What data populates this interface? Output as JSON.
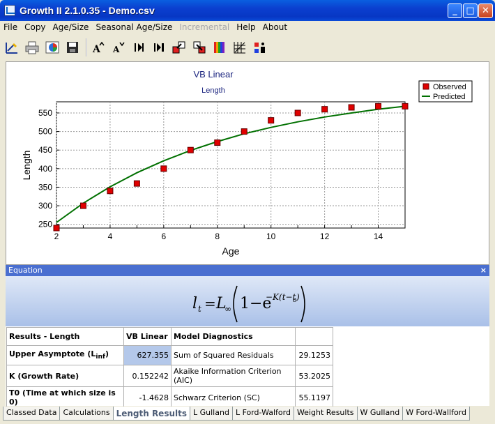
{
  "window": {
    "title": "Growth II 2.1.0.35 - Demo.csv",
    "min": "_",
    "max": "□",
    "close": "✕"
  },
  "menu": [
    "File",
    "Copy",
    "Age/Size",
    "Seasonal Age/Size",
    "Incremental",
    "Help",
    "About"
  ],
  "chart_data": {
    "type": "scatter",
    "title": "VB Linear",
    "subtitle": "Length",
    "xlabel": "Age",
    "ylabel": "Length",
    "xlim": [
      2,
      15
    ],
    "ylim": [
      240,
      580
    ],
    "xticks": [
      2,
      4,
      6,
      8,
      10,
      12,
      14
    ],
    "yticks": [
      250,
      300,
      350,
      400,
      450,
      500,
      550
    ],
    "grid": true,
    "legend_position": "top-right",
    "series": [
      {
        "name": "Observed",
        "kind": "markers",
        "color": "#e00000",
        "x": [
          2,
          3,
          4,
          5,
          6,
          7,
          8,
          9,
          10,
          11,
          12,
          13,
          14,
          15
        ],
        "y": [
          240,
          300,
          340,
          360,
          400,
          450,
          470,
          500,
          530,
          550,
          560,
          565,
          568,
          568
        ]
      },
      {
        "name": "Predicted",
        "kind": "line",
        "color": "#007000",
        "x": [
          2,
          3,
          4,
          5,
          6,
          7,
          8,
          9,
          10,
          11,
          12,
          13,
          14,
          15
        ],
        "y": [
          255,
          307,
          351,
          389,
          421,
          449,
          473,
          494,
          511,
          526,
          539,
          550,
          560,
          568
        ]
      }
    ]
  },
  "equation": {
    "header": "Equation",
    "close": "×",
    "lhs": "l",
    "lhs_sub": "t",
    "equals": "=",
    "linf": "L",
    "linf_sub": "∞",
    "one_minus": "1−e",
    "exponent": "−K(t−t",
    "exponent_sub": "o",
    "exponent_close": ")"
  },
  "results": {
    "headers": [
      "Results - Length",
      "VB Linear",
      "Model Diagnostics",
      ""
    ],
    "rows": [
      {
        "label": "Upper Asymptote (L",
        "label_sub": "inf",
        "label_end": ")",
        "value": "627.355",
        "diag": "Sum of Squared Residuals",
        "diag_value": "29.1253"
      },
      {
        "label": "K (Growth Rate)",
        "value": "0.152242",
        "diag": "Akaike Information Criterion (AIC)",
        "diag_value": "53.2025"
      },
      {
        "label": "T0 (Time at which size is 0)",
        "value": "-1.4628",
        "diag": "Schwarz Criterion (SC)",
        "diag_value": "55.1197"
      }
    ]
  },
  "tabs": [
    "Classed Data",
    "Calculations",
    "Length Results",
    "L Gulland",
    "L Ford-Walford",
    "Weight Results",
    "W Gulland",
    "W Ford-Wallford"
  ],
  "active_tab": "Length Results",
  "colors": {
    "observed": "#e00000",
    "predicted": "#007000",
    "title": "#1a237e"
  }
}
